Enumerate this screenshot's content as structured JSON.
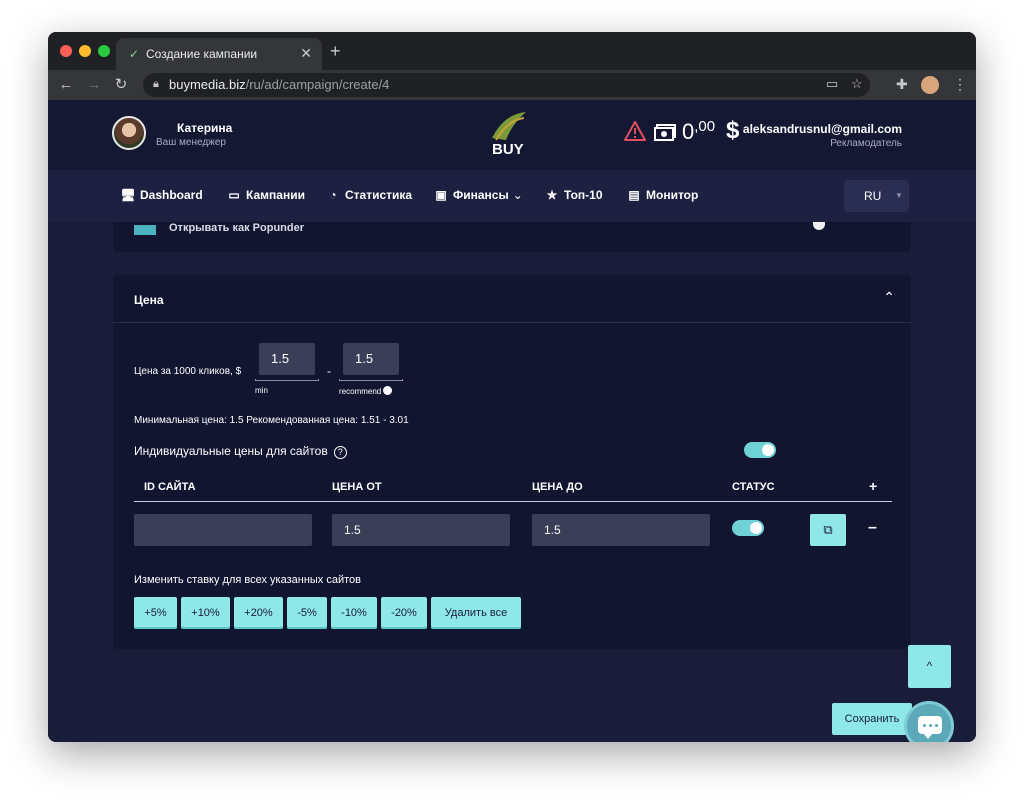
{
  "browser": {
    "tab_title": "Создание кампании",
    "tab_close": "✕",
    "new_tab": "+",
    "url_host": "buymedia.biz",
    "url_path": "/ru/ad/campaign/create/4"
  },
  "header": {
    "manager_name": "Катерина",
    "manager_role": "Ваш менеджер",
    "logo_text": "BUY",
    "balance_main": "0",
    "balance_cents": ",00",
    "currency": "$",
    "email": "aleksandrusnul@gmail.com",
    "user_role": "Рекламодатель"
  },
  "nav": {
    "items": [
      {
        "label": "Dashboard",
        "icon": "monitor-icon"
      },
      {
        "label": "Кампании",
        "icon": "folder-icon"
      },
      {
        "label": "Статистика",
        "icon": "pie-chart-icon"
      },
      {
        "label": "Финансы",
        "icon": "money-icon"
      },
      {
        "label": "Топ-10",
        "icon": "star-icon"
      },
      {
        "label": "Монитор",
        "icon": "document-icon"
      }
    ],
    "language": "RU"
  },
  "partial_card": {
    "label": "Открывать как Popunder"
  },
  "price_card": {
    "title": "Цена",
    "price_label": "Цена за 1000 кликов, $",
    "min_value": "1.5",
    "min_label": "min",
    "recommend_value": "1.5",
    "recommend_label": "recommend",
    "separator": "-",
    "hint": "Минимальная цена: 1.5  Рекомендованная цена: 1.51 - 3.01",
    "individual_label": "Индивидуальные цены для сайтов",
    "individual_enabled": true,
    "table": {
      "headers": [
        "ID САЙТА",
        "ЦЕНА ОТ",
        "ЦЕНА ДО",
        "СТАТУС"
      ],
      "add": "+",
      "rows": [
        {
          "site_id": "",
          "price_from": "1.5",
          "price_to": "1.5",
          "status": true,
          "remove": "–"
        }
      ]
    },
    "change_label": "Изменить ставку для всех указанных сайтов",
    "change_buttons": [
      "+5%",
      "+10%",
      "+20%",
      "-5%",
      "-10%",
      "-20%",
      "Удалить все"
    ]
  },
  "actions": {
    "save": "Сохранить",
    "scroll_top": "^"
  },
  "colors": {
    "accent": "#8ee8e8",
    "background": "#1a1d3a",
    "card": "#121530",
    "alert": "#e04f5f"
  }
}
